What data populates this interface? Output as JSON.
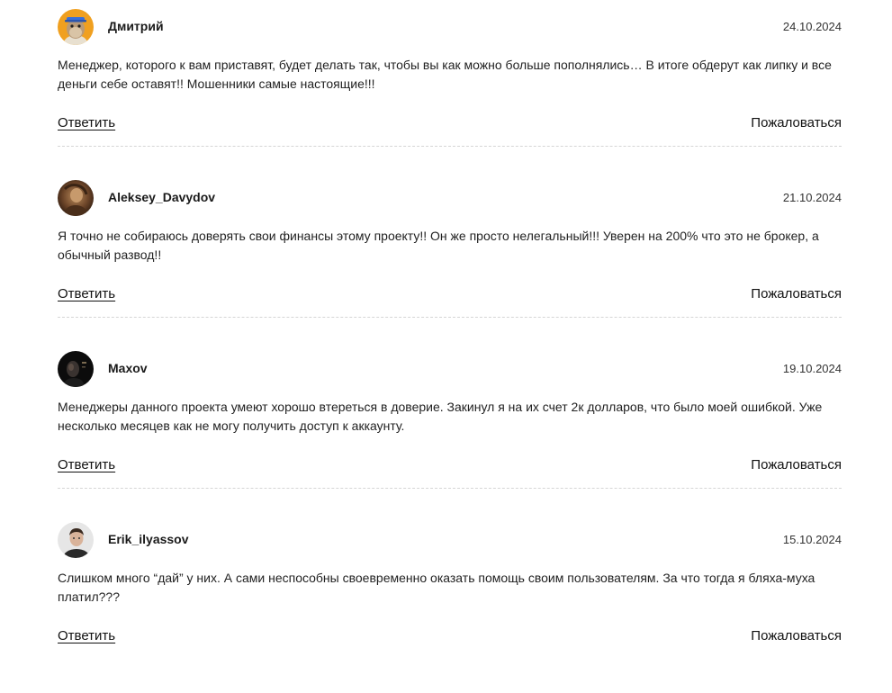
{
  "comments": [
    {
      "author": "Дмитрий",
      "date": "24.10.2024",
      "text": "Менеджер, которого к вам приставят, будет делать так, чтобы вы как можно больше пополнялись… В итоге обдерут как липку и все деньги себе оставят!! Мошенники самые настоящие!!!",
      "reply_label": "Ответить",
      "report_label": "Пожаловаться",
      "avatar_icon": "cartoon-ape-avatar"
    },
    {
      "author": "Aleksey_Davydov",
      "date": "21.10.2024",
      "text": "Я точно не собираюсь доверять свои финансы этому проекту!! Он же просто нелегальный!!! Уверен на 200% что это не брокер, а обычный развод!!",
      "reply_label": "Ответить",
      "report_label": "Пожаловаться",
      "avatar_icon": "photo-avatar"
    },
    {
      "author": "Maxov",
      "date": "19.10.2024",
      "text": "Менеджеры данного проекта умеют хорошо втереться в доверие. Закинул я на их счет 2к долларов, что было моей ошибкой. Уже несколько месяцев как не могу получить доступ к аккаунту.",
      "reply_label": "Ответить",
      "report_label": "Пожаловаться",
      "avatar_icon": "dark-photo-avatar"
    },
    {
      "author": "Erik_ilyassov",
      "date": "15.10.2024",
      "text": "Слишком много “дай” у них. А сами неспособны своевременно оказать помощь своим пользователям. За что тогда я бляха-муха платил???",
      "reply_label": "Ответить",
      "report_label": "Пожаловаться",
      "avatar_icon": "person-photo-avatar"
    }
  ],
  "colors": {
    "text": "#222222",
    "divider": "#d6d6d6",
    "background": "#ffffff"
  }
}
